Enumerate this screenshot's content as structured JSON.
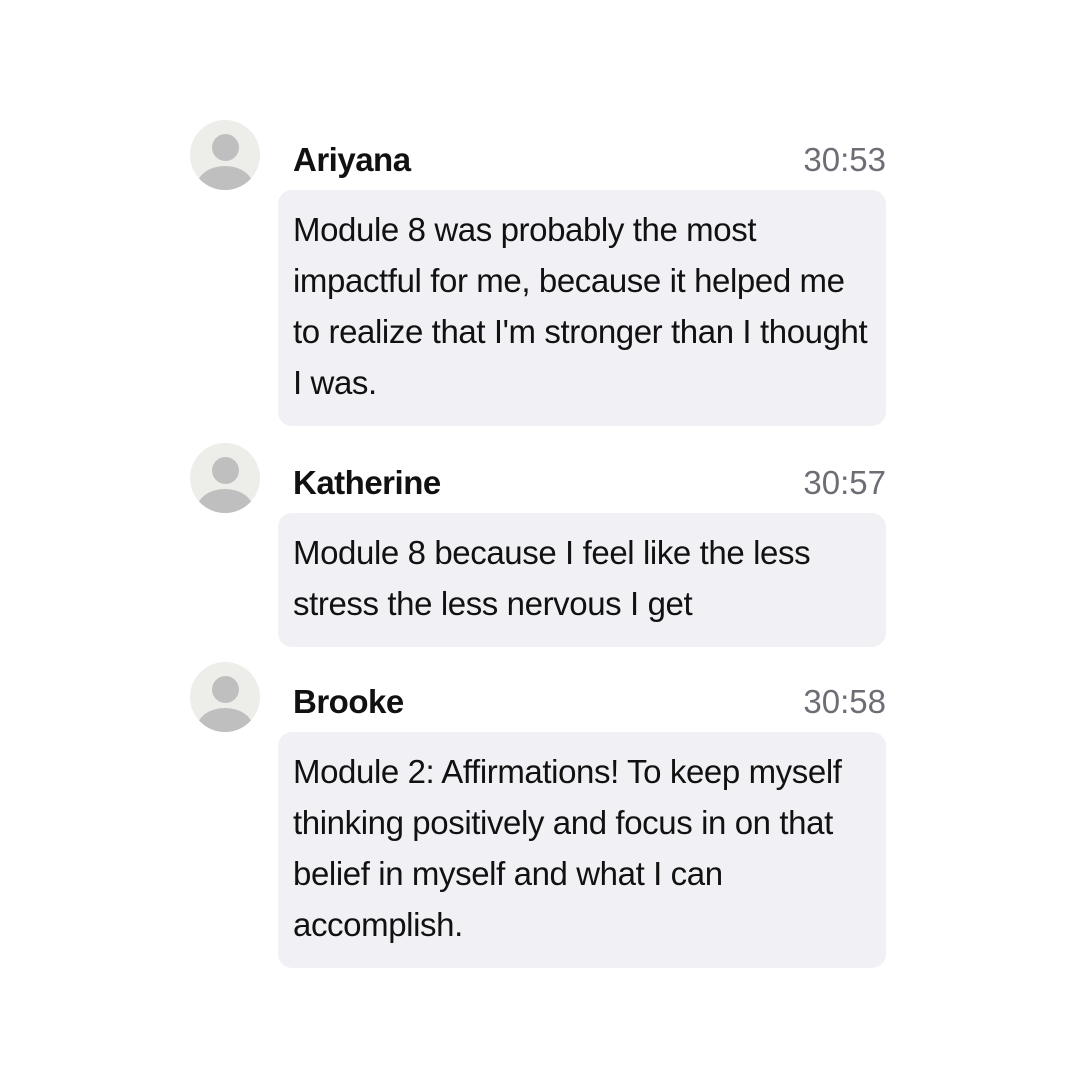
{
  "messages": [
    {
      "author": "Ariyana",
      "time": "30:53",
      "text": "Module 8 was probably the most impactful for me, because it helped me to realize that I'm stronger than I thought I was."
    },
    {
      "author": "Katherine",
      "time": "30:57",
      "text": "Module 8 because I feel like the less stress the less nervous I get"
    },
    {
      "author": "Brooke",
      "time": "30:58",
      "text": "Module 2: Affirmations! To keep myself thinking positively and focus in on that belief in myself and what I can accomplish."
    }
  ],
  "icons": {
    "avatar": "default-user-avatar-icon"
  },
  "colors": {
    "bubble_background": "#f1f1f5",
    "avatar_background": "#ededea",
    "avatar_silhouette": "#bfbfbf",
    "timestamp": "#6d6d75",
    "text": "#111111"
  }
}
